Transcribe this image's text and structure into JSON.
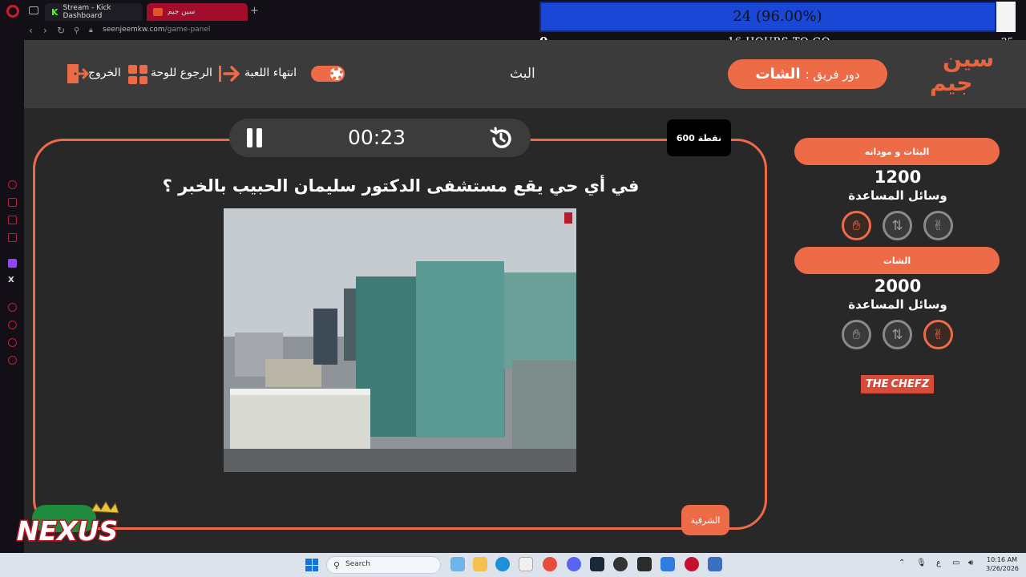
{
  "browser": {
    "tabs": [
      {
        "label": "Stream - Kick Dashboard",
        "icon": "kick-icon"
      },
      {
        "label": "سين جيم",
        "icon": "site-icon"
      }
    ],
    "url_domain": "seenjeemkw.com",
    "url_path": "/game-panel"
  },
  "stream_overlay": {
    "progress_label": "24  (96.00%)",
    "progress_value": 0.96,
    "start_value": "0",
    "time_left": "-16 HOURS TO GO",
    "end_value": "25"
  },
  "header": {
    "brand_line1": "سين",
    "brand_line2": "جيم",
    "turn_label": "دور فريق :",
    "turn_team": "الشات",
    "title": "البث",
    "end_game": "انتهاء اللعبة",
    "back_to_board": "الرجوع للوحة",
    "exit": "الخروج"
  },
  "question": {
    "timer": "00:23",
    "points": "600 نقطة",
    "text": "في أي حي يقع مستشفى الدكتور سليمان الحبيب بالخبر ؟",
    "category_tab": "الشرقية"
  },
  "teams": [
    {
      "name": "البثات و مودانه",
      "score": "1200",
      "aids_label": "وسائل المساعدة",
      "active_aid": "hand-icon"
    },
    {
      "name": "الشات",
      "score": "2000",
      "aids_label": "وسائل المساعدة",
      "active_aid": "peace-icon"
    }
  ],
  "sponsor": {
    "the": "THE",
    "name": "CHEFZ"
  },
  "watermark": "NEXUS",
  "taskbar": {
    "search": "Search",
    "lang": "ع",
    "time": "10:16 AM",
    "date": "3/26/2026"
  },
  "colors": {
    "accent": "#ee6b47",
    "header_bg": "#3b3b3b",
    "main_bg": "#282828"
  }
}
